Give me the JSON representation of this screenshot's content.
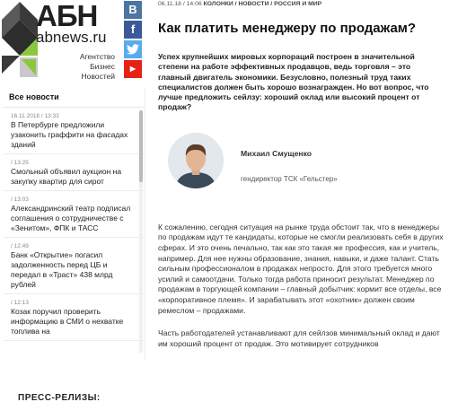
{
  "logo": {
    "brand": "АБН",
    "domain": "abnews.ru",
    "tagline": [
      "Агентство",
      "Бизнес",
      "Новостей"
    ],
    "colors": {
      "mark_dark": "#3a3a3a",
      "mark_green": "#8cc63f",
      "mark_light": "#c8c8c8"
    }
  },
  "social": [
    {
      "name": "vk",
      "glyph": "В"
    },
    {
      "name": "facebook",
      "glyph": "f"
    },
    {
      "name": "twitter",
      "glyph": "t"
    },
    {
      "name": "youtube",
      "glyph": "▶"
    }
  ],
  "sidebar": {
    "news_header": "Все новости",
    "news": [
      {
        "time": "16.11.2018 / 13:33",
        "title": "В Петербурге предложили узаконить граффити на фасадах зданий"
      },
      {
        "time": "/ 13:25",
        "title": "Смольный объявил аукцион на закупку квартир для сирот"
      },
      {
        "time": "/ 13:03",
        "title": "Александринский театр подписал соглашения о сотрудничестве с «Зенитом», ФПК и ТАСС"
      },
      {
        "time": "/ 12:49",
        "title": "Банк «Открытие» погасил задолженность перед ЦБ и передал в «Траст» 438 млрд рублей"
      },
      {
        "time": "/ 12:13",
        "title": "Козак поручил проверить информацию в СМИ о нехватке топлива на"
      }
    ],
    "press_title": "ПРЕСС-РЕЛИЗЫ:"
  },
  "article": {
    "meta": {
      "date": "06.11.18 / 14:06",
      "sections": "КОЛОНКИ / НОВОСТИ / РОССИЯ И МИР"
    },
    "title": "Как платить менеджеру по продажам?",
    "lead": "Успех крупнейших мировых корпораций построен в значительной степени на работе эффективных продавцов, ведь торговля – это главный двигатель экономики. Безусловно, полезный труд таких специалистов должен быть хорошо вознагражден. Но вот вопрос, что лучше предложить сейлзу: хороший оклад или высокий процент от продаж?",
    "author": {
      "name": "Михаил Смущенко",
      "role": "гендиректор ТСК «Гельстер»"
    },
    "paragraphs": [
      "К сожалению, сегодня ситуация на рынке труда обстоит так, что в менеджеры по продажам идут те кандидаты, которые не смогли реализовать себя в других сферах. И это очень печально, так как это такая же профессия, как и учитель, например. Для нее нужны образование, знания, навыки, и даже талант. Стать сильным профессионалом в продажах непросто. Для этого требуется много усилий и самоотдачи. Только тогда работа приносит результат. Менеджер по продажам в торгующей компании – главный добытчик: кормит все отделы, все «корпоративное племя». И зарабатывать этот «охотник» должен своим ремеслом – продажами.",
      "Часть работодателей устанавливают для сейлзов минимальный оклад и дают им хороший процент от продаж. Это мотивирует сотрудников"
    ]
  }
}
